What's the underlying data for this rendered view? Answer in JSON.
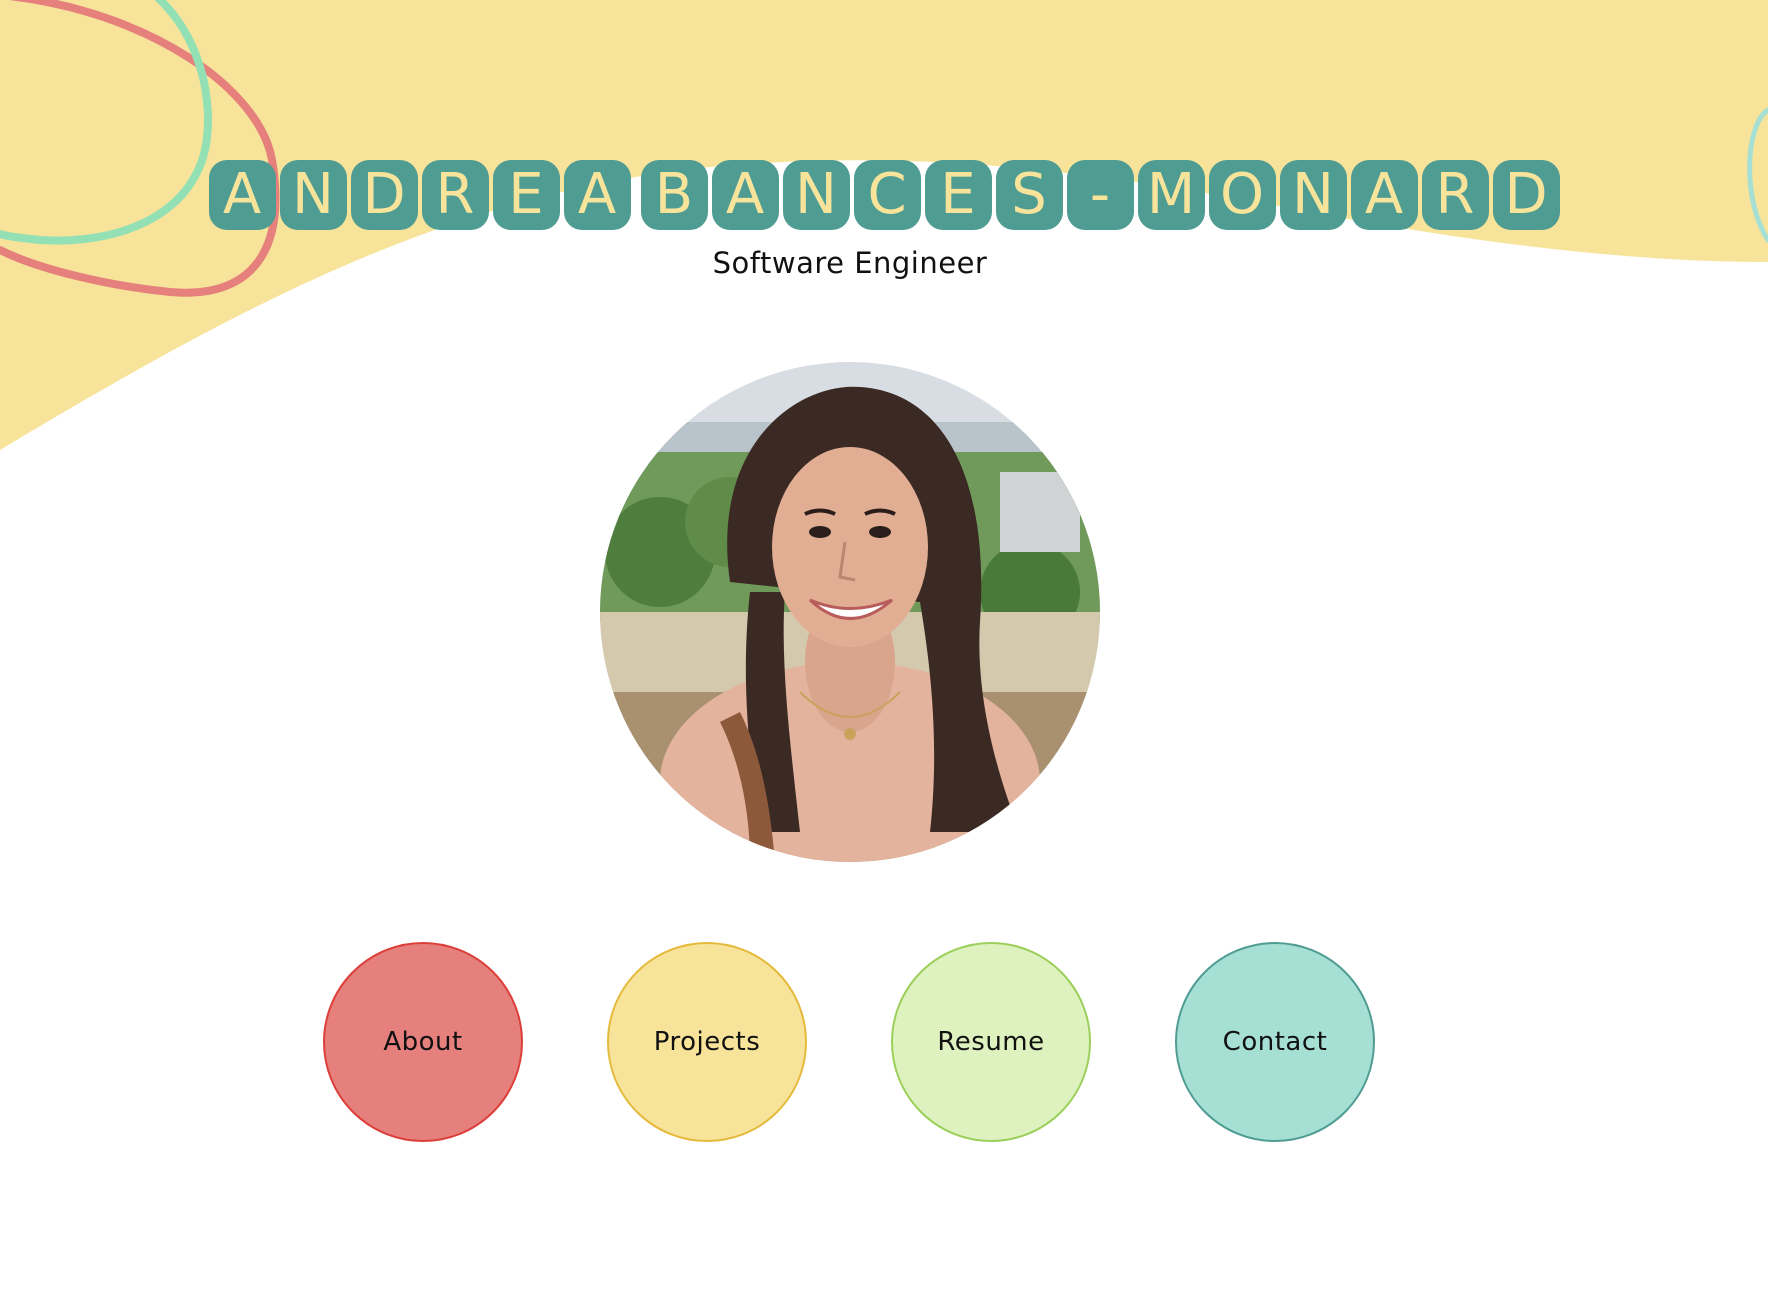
{
  "header": {
    "name_words": [
      [
        "A",
        "N",
        "D",
        "R",
        "E",
        "A"
      ],
      [
        "B",
        "A",
        "N",
        "C",
        "E",
        "S",
        "-",
        "M",
        "O",
        "N",
        "A",
        "R",
        "D"
      ]
    ],
    "name_full": "Andrea Bances-Monard",
    "subtitle": "Software Engineer"
  },
  "profile": {
    "photo_alt": "profile-photo"
  },
  "nav": {
    "items": [
      {
        "label": "About",
        "color": "#e5807d",
        "border": "#dc3f3a"
      },
      {
        "label": "Projects",
        "color": "#f7e49a",
        "border": "#e5b93b"
      },
      {
        "label": "Resume",
        "color": "#def2bf",
        "border": "#9bcf5a"
      },
      {
        "label": "Contact",
        "color": "#a6e0d4",
        "border": "#4f9c93"
      }
    ]
  },
  "theme": {
    "banner_yellow": "#f7e49a",
    "title_teal": "#4f9c93",
    "squiggle_red": "#e5807d",
    "squiggle_green": "#93e0b5"
  }
}
